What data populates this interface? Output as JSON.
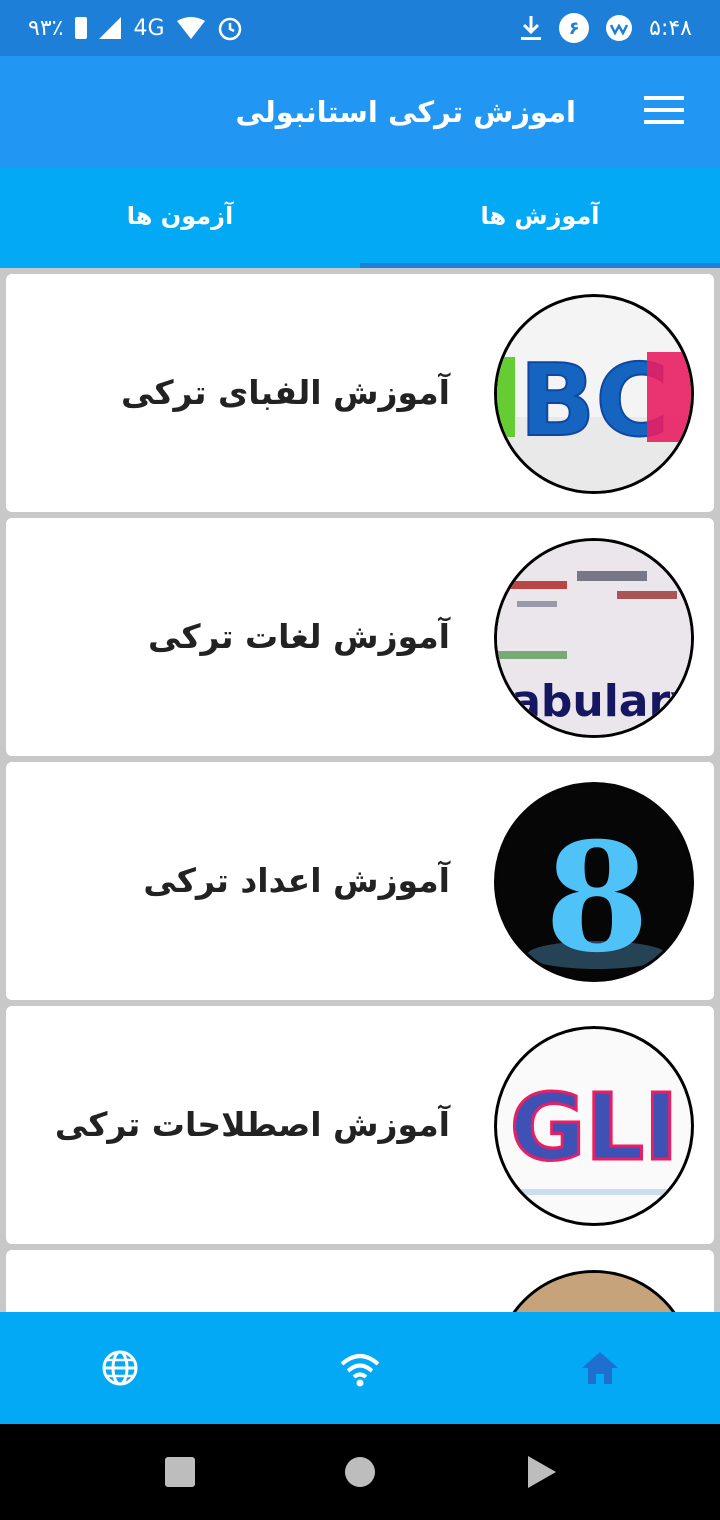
{
  "status_bar": {
    "battery": "۹۳٪",
    "network": "4G",
    "time": "۵:۴۸",
    "notification_badge": "۶"
  },
  "app_bar": {
    "title": "اموزش ترکی استانبولی",
    "menu_icon": "hamburger-menu-icon"
  },
  "tabs": [
    {
      "label": "آموزش ها",
      "selected": true
    },
    {
      "label": "آزمون ها",
      "selected": false
    }
  ],
  "list": [
    {
      "label": "آموزش الفبای ترکی",
      "thumb_text": "BC"
    },
    {
      "label": "آموزش لغات ترکی",
      "thumb_text": "cabulary"
    },
    {
      "label": "آموزش اعداد ترکی",
      "thumb_text": "8"
    },
    {
      "label": "آموزش اصطلاحات ترکی",
      "thumb_text": "GLI"
    },
    {
      "label": "",
      "thumb_text": ""
    }
  ],
  "bottom_nav": [
    {
      "icon": "home-icon",
      "active": true
    },
    {
      "icon": "wifi-icon",
      "active": false
    },
    {
      "icon": "globe-icon",
      "active": false
    }
  ],
  "colors": {
    "status_bar": "#1e7fd8",
    "app_bar": "#2196f3",
    "tabs": "#03a9f4",
    "active_icon": "#1e6fd0"
  }
}
